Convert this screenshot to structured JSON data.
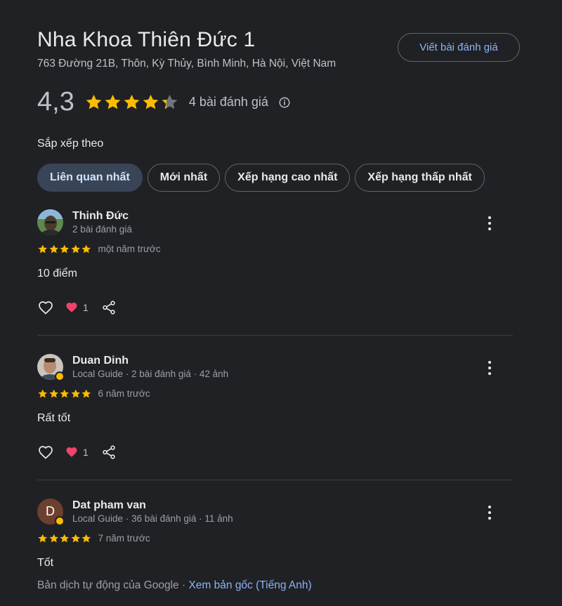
{
  "header": {
    "place_name": "Nha Khoa Thiên Đức 1",
    "address": "763 Đường 21B, Thôn, Kỳ Thủy, Bình Minh, Hà Nội, Việt Nam",
    "write_review_label": "Viết bài đánh giá"
  },
  "summary": {
    "rating": "4,3",
    "rating_value": 4.3,
    "stars_max": 5,
    "review_count_label": "4 bài đánh giá",
    "info_icon": "info-icon"
  },
  "sort": {
    "label": "Sắp xếp theo",
    "options": [
      "Liên quan nhất",
      "Mới nhất",
      "Xếp hạng cao nhất",
      "Xếp hạng thấp nhất"
    ],
    "selected": "Liên quan nhất"
  },
  "reviews": [
    {
      "name": "Thinh Đức",
      "meta": "2 bài đánh giá",
      "avatar": "photo",
      "stars": 5,
      "time": "một năm trước",
      "text": "10 điểm",
      "reaction_count": "1"
    },
    {
      "name": "Duan Dinh",
      "meta": "Local Guide · 2 bài đánh giá · 42 ảnh",
      "avatar": "photo",
      "stars": 5,
      "time": "6 năm trước",
      "text": "Rất tốt",
      "reaction_count": "1"
    },
    {
      "name": "Dat pham van",
      "meta": "Local Guide · 36 bài đánh giá · 11 ảnh",
      "avatar_letter": "D",
      "stars": 5,
      "time": "7 năm trước",
      "text": "Tốt",
      "translation_note": "Bản dịch tự động của Google · ",
      "translation_link": "Xem bản gốc (Tiếng Anh)"
    }
  ],
  "colors": {
    "background": "#202124",
    "star": "#fbbc04",
    "link": "#8ab4f8",
    "active_chip": "#394457",
    "heart": "#f0436a"
  }
}
